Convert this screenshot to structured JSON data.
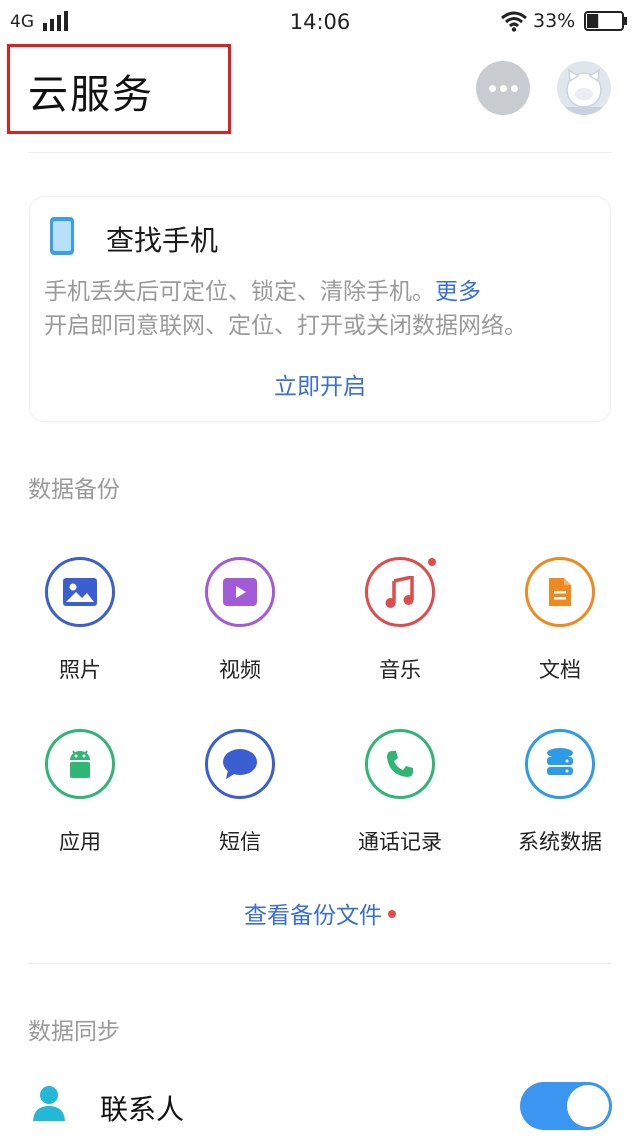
{
  "status_bar": {
    "network": "4G",
    "time": "14:06",
    "battery_percent": "33%",
    "battery_level": 0.33
  },
  "header": {
    "title": "云服务",
    "more_icon": "more-dots-icon",
    "avatar_icon": "avatar-icon"
  },
  "find_phone": {
    "title": "查找手机",
    "desc_line1": "手机丢失后可定位、锁定、清除手机。",
    "more_link": "更多",
    "desc_line2": "开启即同意联网、定位、打开或关闭数据网络。",
    "enable_label": "立即开启"
  },
  "backup": {
    "section_title": "数据备份",
    "items": [
      {
        "label": "照片",
        "icon": "photo-icon",
        "color": "#3b5fd1"
      },
      {
        "label": "视频",
        "icon": "video-icon",
        "color": "#a25ad9"
      },
      {
        "label": "音乐",
        "icon": "music-icon",
        "color": "#e04b4b",
        "badge": true
      },
      {
        "label": "文档",
        "icon": "document-icon",
        "color": "#f08a20"
      },
      {
        "label": "应用",
        "icon": "android-icon",
        "color": "#2fb574"
      },
      {
        "label": "短信",
        "icon": "message-icon",
        "color": "#3b5fd1"
      },
      {
        "label": "通话记录",
        "icon": "phone-call-icon",
        "color": "#2fb574"
      },
      {
        "label": "系统数据",
        "icon": "database-icon",
        "color": "#2d9be6"
      }
    ],
    "view_files_label": "查看备份文件"
  },
  "sync": {
    "section_title": "数据同步",
    "contacts_label": "联系人",
    "contacts_enabled": true
  },
  "colors": {
    "accent": "#3a6fd8",
    "highlight_box": "#e02020",
    "toggle_on": "#3a96f0"
  }
}
